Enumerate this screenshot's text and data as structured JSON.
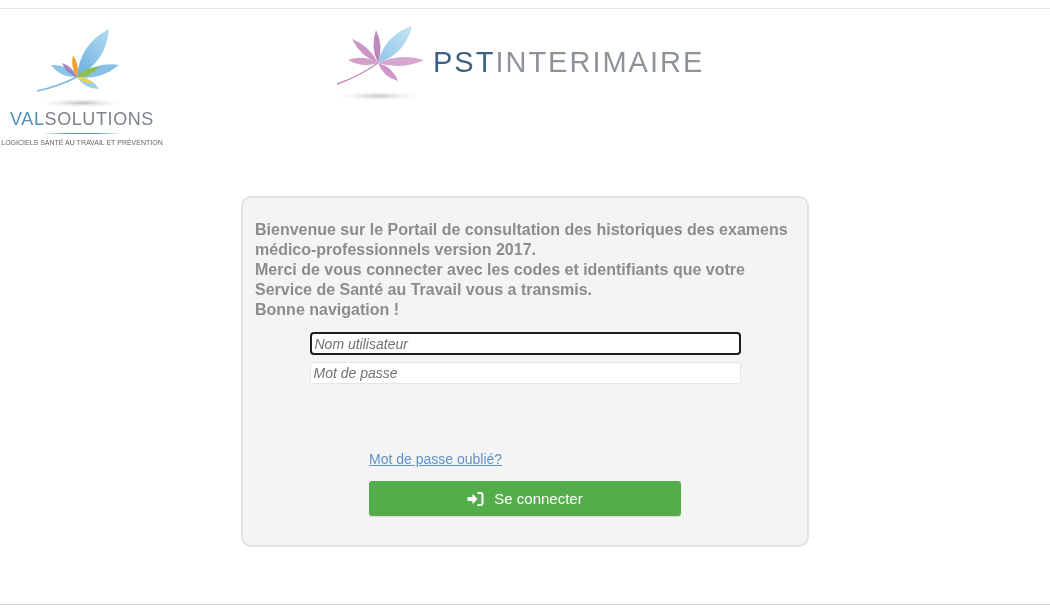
{
  "logos": {
    "left": {
      "wordmark": {
        "lead": "VAL",
        "rest": "SOLUTIONS"
      },
      "tagline": "LOGICIELS SANTÉ AU TRAVAIL ET PRÉVENTION"
    },
    "center": {
      "wordmark": {
        "lead": "PST",
        "rest": "INTERIMAIRE"
      }
    }
  },
  "login": {
    "message": [
      "Bienvenue sur le Portail de consultation des historiques des examens médico-professionnels version 2017.",
      "Merci de vous connecter avec les codes et identifiants que votre Service de Santé au Travail vous a transmis.",
      "Bonne navigation !"
    ],
    "fields": [
      {
        "placeholder": "Nom utilisateur",
        "focused": true
      },
      {
        "placeholder": "Mot de passe",
        "focused": false
      }
    ],
    "forgot_link": "Mot de passe oublié?",
    "submit": {
      "label": "Se connecter"
    }
  }
}
